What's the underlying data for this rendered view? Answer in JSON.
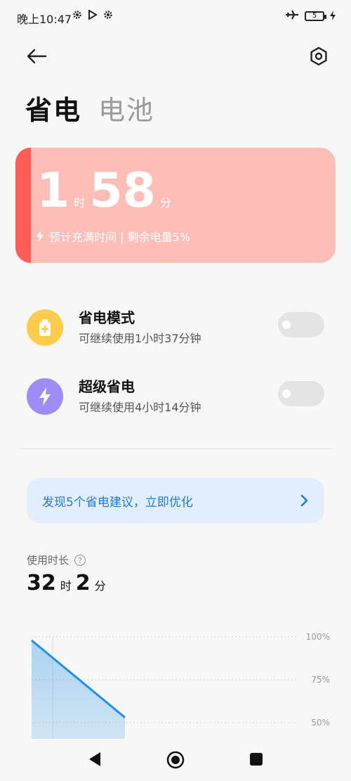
{
  "status_bar": {
    "time": "晚上10:47",
    "battery_level": "5"
  },
  "header": {
    "tabs": [
      {
        "label": "省电",
        "active": true
      },
      {
        "label": "电池",
        "active": false
      }
    ]
  },
  "battery_card": {
    "hours": "1",
    "hours_unit": "时",
    "minutes": "58",
    "minutes_unit": "分",
    "subtitle": "预计充满时间 | 剩余电量5%",
    "charge_fraction": 0.05,
    "colors": {
      "background": "#ffbdb8",
      "fill": "#ff5d55"
    }
  },
  "modes": [
    {
      "title": "省电模式",
      "subtitle": "可继续使用1小时37分钟",
      "enabled": false,
      "icon": "battery-plus-icon",
      "color": "#ffcc4d"
    },
    {
      "title": "超级省电",
      "subtitle": "可继续使用4小时14分钟",
      "enabled": false,
      "icon": "lightning-icon",
      "color": "#9f8cf5"
    }
  ],
  "suggestion": {
    "text": "发现5个省电建议，立即优化"
  },
  "usage": {
    "label": "使用时长",
    "hours": "32",
    "hours_unit": "时",
    "minutes": "2",
    "minutes_unit": "分"
  },
  "chart_data": {
    "type": "area",
    "y_tick_labels": [
      "100%",
      "75%",
      "50%"
    ],
    "ylim": [
      0,
      100
    ],
    "series": [
      {
        "x": [
          0,
          1
        ],
        "values": [
          98,
          53
        ]
      }
    ],
    "color": "#1e90e6"
  }
}
